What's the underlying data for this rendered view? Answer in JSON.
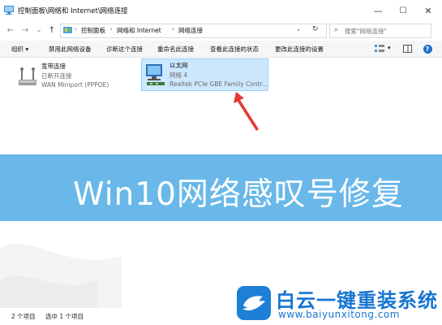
{
  "window": {
    "title": "控制面板\\网络和 Internet\\网络连接",
    "controls": {
      "minimize": "—",
      "maximize": "☐",
      "close": "✕"
    }
  },
  "navigation": {
    "back": "←",
    "forward": "→",
    "recent": "⌄",
    "up": "↑",
    "breadcrumbs": [
      "控制面板",
      "网络和 Internet",
      "网络连接"
    ],
    "separator": "›",
    "dropdown": "⌄",
    "refresh": "↻",
    "search_placeholder": "搜索\"网络连接\""
  },
  "toolbar": {
    "items": [
      "组织 ▾",
      "禁用此网络设备",
      "诊断这个连接",
      "重命名此连接",
      "查看此连接的状态",
      "更改此连接的设置"
    ],
    "view_icon": "view-options-icon",
    "view_caret": "▾",
    "help": "?"
  },
  "connections": [
    {
      "name": "宽带连接",
      "status": "已断开连接",
      "device": "WAN Miniport (PPPOE)",
      "selected": false
    },
    {
      "name": "以太网",
      "status": "网络 4",
      "device": "Realtek PCIe GBE Family Contr...",
      "selected": true
    }
  ],
  "statusbar": {
    "count": "2 个项目",
    "selected": "选中 1 个项目"
  },
  "banner": {
    "text": "Win10网络感叹号修复"
  },
  "watermark": {
    "name": "白云一键重装系统",
    "url": "www.baiyunxitong.com"
  },
  "colors": {
    "banner": "#48a8e4",
    "selection": "#cce8ff",
    "brand": "#1775d1",
    "arrow": "#e53935"
  }
}
